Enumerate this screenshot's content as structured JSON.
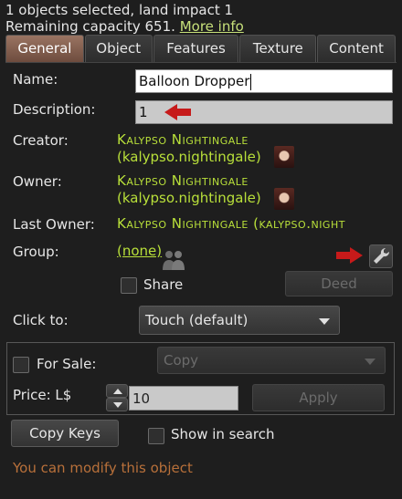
{
  "header": {
    "selection_text": "1 objects selected, land impact 1",
    "capacity_text": "Remaining capacity 651.",
    "more_info_link": "More info"
  },
  "tabs": [
    {
      "label": "General",
      "active": true
    },
    {
      "label": "Object",
      "active": false
    },
    {
      "label": "Features",
      "active": false
    },
    {
      "label": "Texture",
      "active": false
    },
    {
      "label": "Content",
      "active": false
    }
  ],
  "general": {
    "name_label": "Name:",
    "name_value": "Balloon Dropper",
    "description_label": "Description:",
    "description_value": "1",
    "creator_label": "Creator:",
    "creator_name": "Kalypso Nightingale",
    "creator_username": "(kalypso.nightingale)",
    "owner_label": "Owner:",
    "owner_name": "Kalypso Nightingale",
    "owner_username": "(kalypso.nightingale)",
    "last_owner_label": "Last Owner:",
    "last_owner_text": "Kalypso Nightingale (kalypso.night",
    "group_label": "Group:",
    "group_value": "(none)",
    "share_label": "Share",
    "deed_button": "Deed",
    "click_to_label": "Click to:",
    "click_to_value": "Touch  (default)",
    "for_sale_label": "For Sale:",
    "sale_type_value": "Copy",
    "price_label": "Price: L$",
    "price_value": "10",
    "apply_button": "Apply",
    "copy_keys_button": "Copy Keys",
    "show_in_search_label": "Show in search",
    "status_text": "You can modify this object"
  },
  "colors": {
    "accent_tab": "#8a6453",
    "name_green": "#b9e03a",
    "status_orange": "#b8703a",
    "annotation_arrow": "#c61a1a"
  },
  "icons": [
    "avatar-icon",
    "group-icon",
    "wrench-icon",
    "dropdown-arrow-icon",
    "spinner-up-icon",
    "spinner-down-icon",
    "red-arrow-annotation"
  ]
}
